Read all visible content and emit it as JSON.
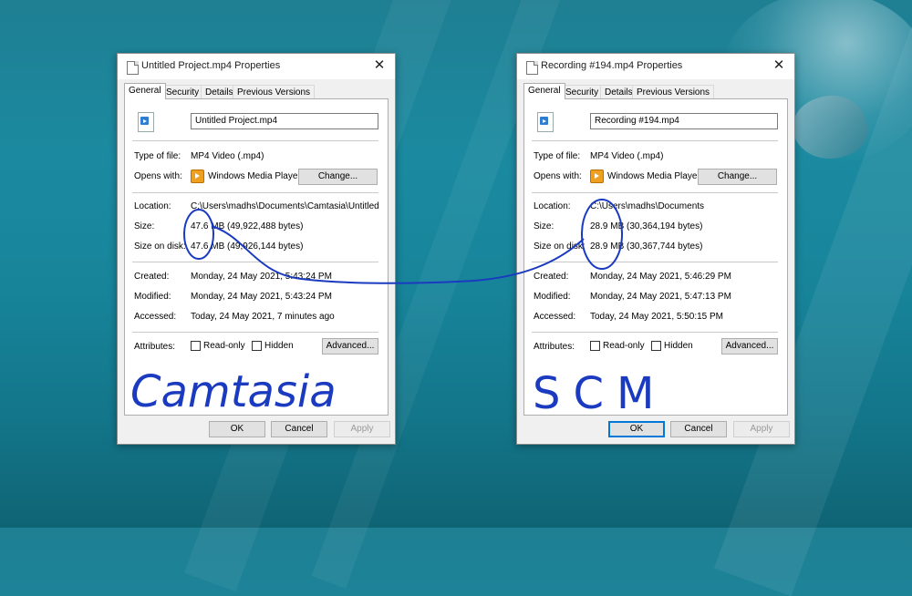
{
  "colors": {
    "ink": "#1a3ac0",
    "accent": "#0078d7",
    "window_bg": "#f0f0f0"
  },
  "dialogs": [
    {
      "title": "Untitled Project.mp4 Properties",
      "tabs": [
        "General",
        "Security",
        "Details",
        "Previous Versions"
      ],
      "filename": "Untitled Project.mp4",
      "type_label": "Type of file:",
      "type_value": "MP4 Video (.mp4)",
      "opens_label": "Opens with:",
      "opens_value": "Windows Media Player",
      "change_label": "Change...",
      "location_label": "Location:",
      "location_value": "C:\\Users\\madhs\\Documents\\Camtasia\\Untitled Proj",
      "size_label": "Size:",
      "size_value": "47.6 MB (49,922,488 bytes)",
      "size_on_disk_label": "Size on disk:",
      "size_on_disk_value": "47.6 MB (49,926,144 bytes)",
      "created_label": "Created:",
      "created_value": "Monday, 24 May 2021, 5:43:24 PM",
      "modified_label": "Modified:",
      "modified_value": "Monday, 24 May 2021, 5:43:24 PM",
      "accessed_label": "Accessed:",
      "accessed_value": "Today, 24 May 2021, 7 minutes ago",
      "attributes_label": "Attributes:",
      "readonly_label": "Read-only",
      "hidden_label": "Hidden",
      "advanced_label": "Advanced...",
      "ok_label": "OK",
      "cancel_label": "Cancel",
      "apply_label": "Apply",
      "annotation": "Camtasia"
    },
    {
      "title": "Recording #194.mp4 Properties",
      "tabs": [
        "General",
        "Security",
        "Details",
        "Previous Versions"
      ],
      "filename": "Recording #194.mp4",
      "type_label": "Type of file:",
      "type_value": "MP4 Video (.mp4)",
      "opens_label": "Opens with:",
      "opens_value": "Windows Media Player",
      "change_label": "Change...",
      "location_label": "Location:",
      "location_value": "C:\\Users\\madhs\\Documents",
      "size_label": "Size:",
      "size_value": "28.9 MB (30,364,194 bytes)",
      "size_on_disk_label": "Size on disk:",
      "size_on_disk_value": "28.9 MB (30,367,744 bytes)",
      "created_label": "Created:",
      "created_value": "Monday, 24 May 2021, 5:46:29 PM",
      "modified_label": "Modified:",
      "modified_value": "Monday, 24 May 2021, 5:47:13 PM",
      "accessed_label": "Accessed:",
      "accessed_value": "Today, 24 May 2021, 5:50:15 PM",
      "attributes_label": "Attributes:",
      "readonly_label": "Read-only",
      "hidden_label": "Hidden",
      "advanced_label": "Advanced...",
      "ok_label": "OK",
      "cancel_label": "Cancel",
      "apply_label": "Apply",
      "annotation": "SCM"
    }
  ],
  "icons": {
    "title": "file-icon",
    "close": "close-icon",
    "file": "video-file-icon",
    "app": "windows-media-player-icon"
  }
}
